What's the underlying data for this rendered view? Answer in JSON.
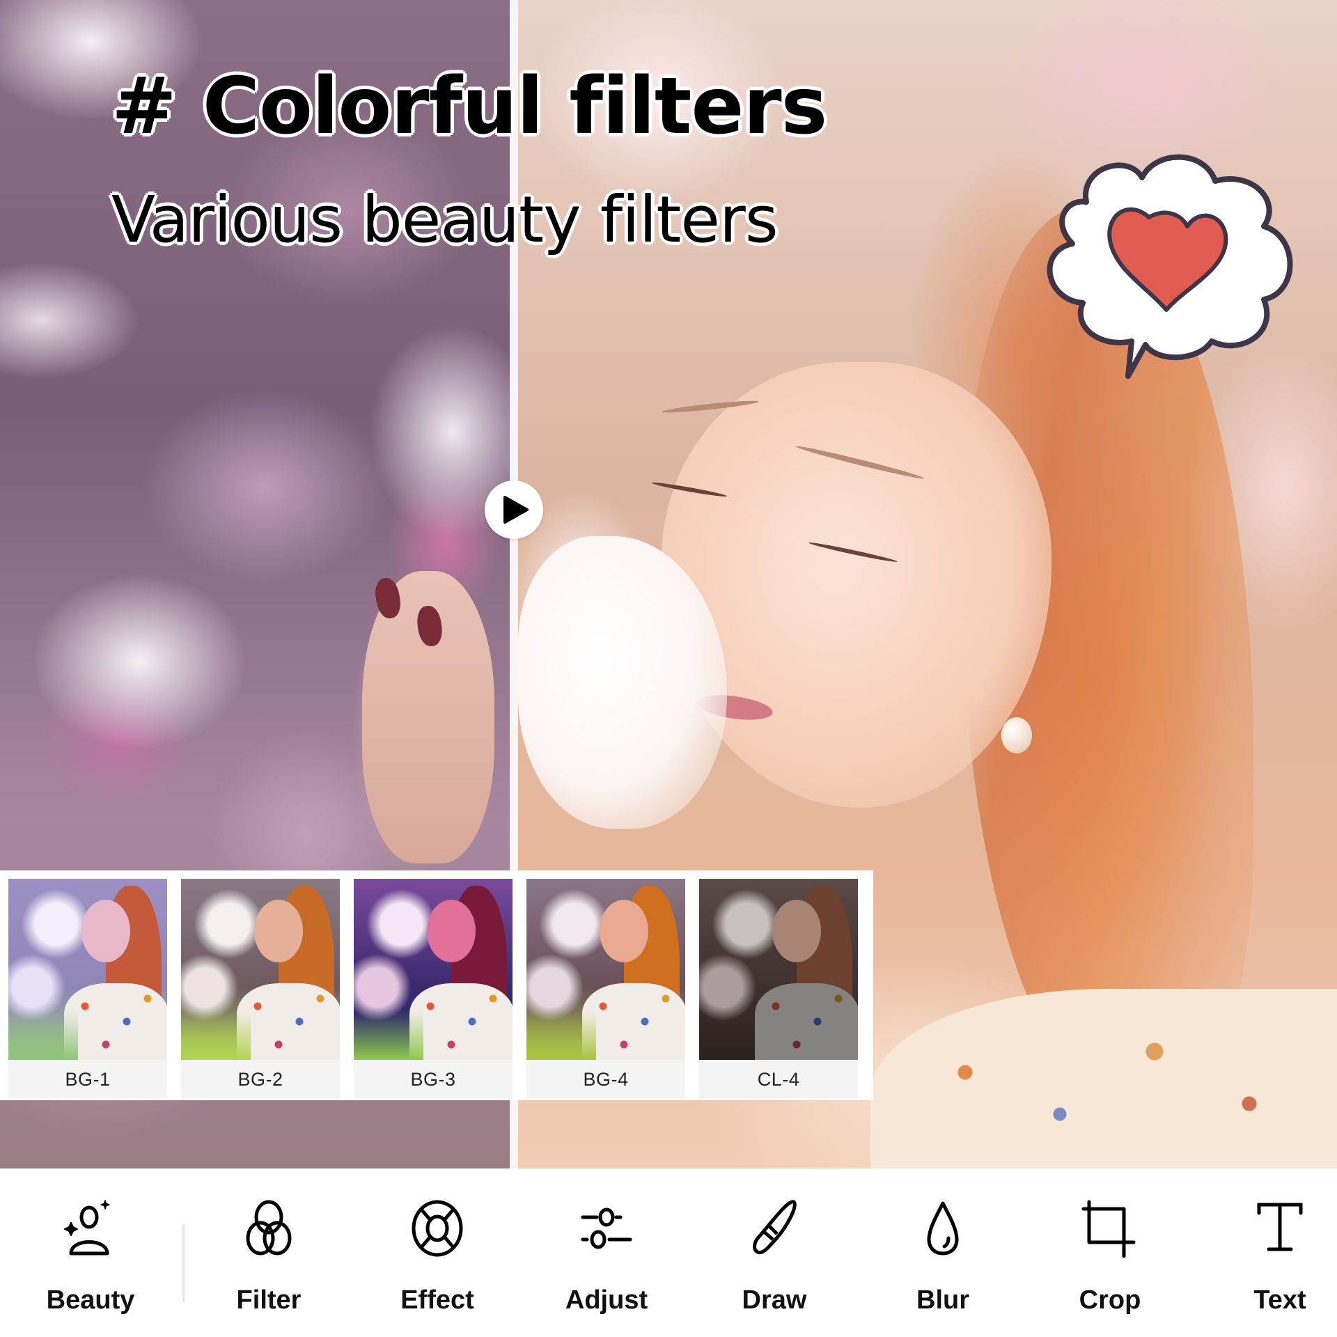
{
  "headline": {
    "title": "# Colorful filters",
    "subtitle": "Various beauty filters"
  },
  "preview": {
    "mode": "before-after comparison",
    "compare_handle_icon": "play-icon",
    "sticker": {
      "type": "thought-bubble",
      "icon": "heart-icon",
      "heart_color": "#e25b50",
      "outline_color": "#3e3548"
    }
  },
  "filters": [
    {
      "label": "BG-1",
      "tint": "#b9a6d6"
    },
    {
      "label": "BG-2",
      "tint": "#c89a7a"
    },
    {
      "label": "BG-3",
      "tint": "#d0457e"
    },
    {
      "label": "BG-4",
      "tint": "#d99060"
    },
    {
      "label": "CL-4",
      "tint": "#5a4640"
    }
  ],
  "toolbar": {
    "items": [
      {
        "label": "Beauty",
        "icon": "beauty-person-sparkle-icon"
      },
      {
        "label": "Filter",
        "icon": "filter-circles-icon"
      },
      {
        "label": "Effect",
        "icon": "effect-lifebuoy-icon"
      },
      {
        "label": "Adjust",
        "icon": "adjust-sliders-icon"
      },
      {
        "label": "Draw",
        "icon": "brush-icon"
      },
      {
        "label": "Blur",
        "icon": "droplet-icon"
      },
      {
        "label": "Crop",
        "icon": "crop-icon"
      },
      {
        "label": "Text",
        "icon": "text-icon"
      }
    ]
  }
}
